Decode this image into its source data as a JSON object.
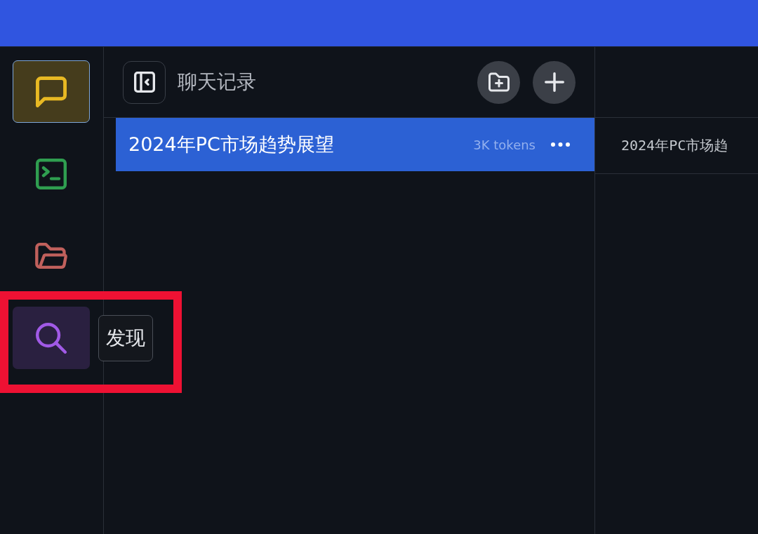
{
  "rail": {
    "items": [
      {
        "kind": "chat",
        "color": "#e8b923",
        "selected": true,
        "hovered": false,
        "highlighted": false
      },
      {
        "kind": "terminal",
        "color": "#2f9e50",
        "selected": false,
        "hovered": false,
        "highlighted": false
      },
      {
        "kind": "folder",
        "color": "#c0605c",
        "selected": false,
        "hovered": false,
        "highlighted": false
      },
      {
        "kind": "search",
        "color": "#a15ae6",
        "selected": false,
        "hovered": true,
        "highlighted": true,
        "tooltip": "发现"
      }
    ]
  },
  "chat_panel": {
    "title": "聊天记录",
    "chats": [
      {
        "title": "2024年PC市场趋势展望",
        "tokens": "3K tokens",
        "selected": true
      }
    ]
  },
  "conversation": {
    "title": "2024年PC市场趋"
  }
}
